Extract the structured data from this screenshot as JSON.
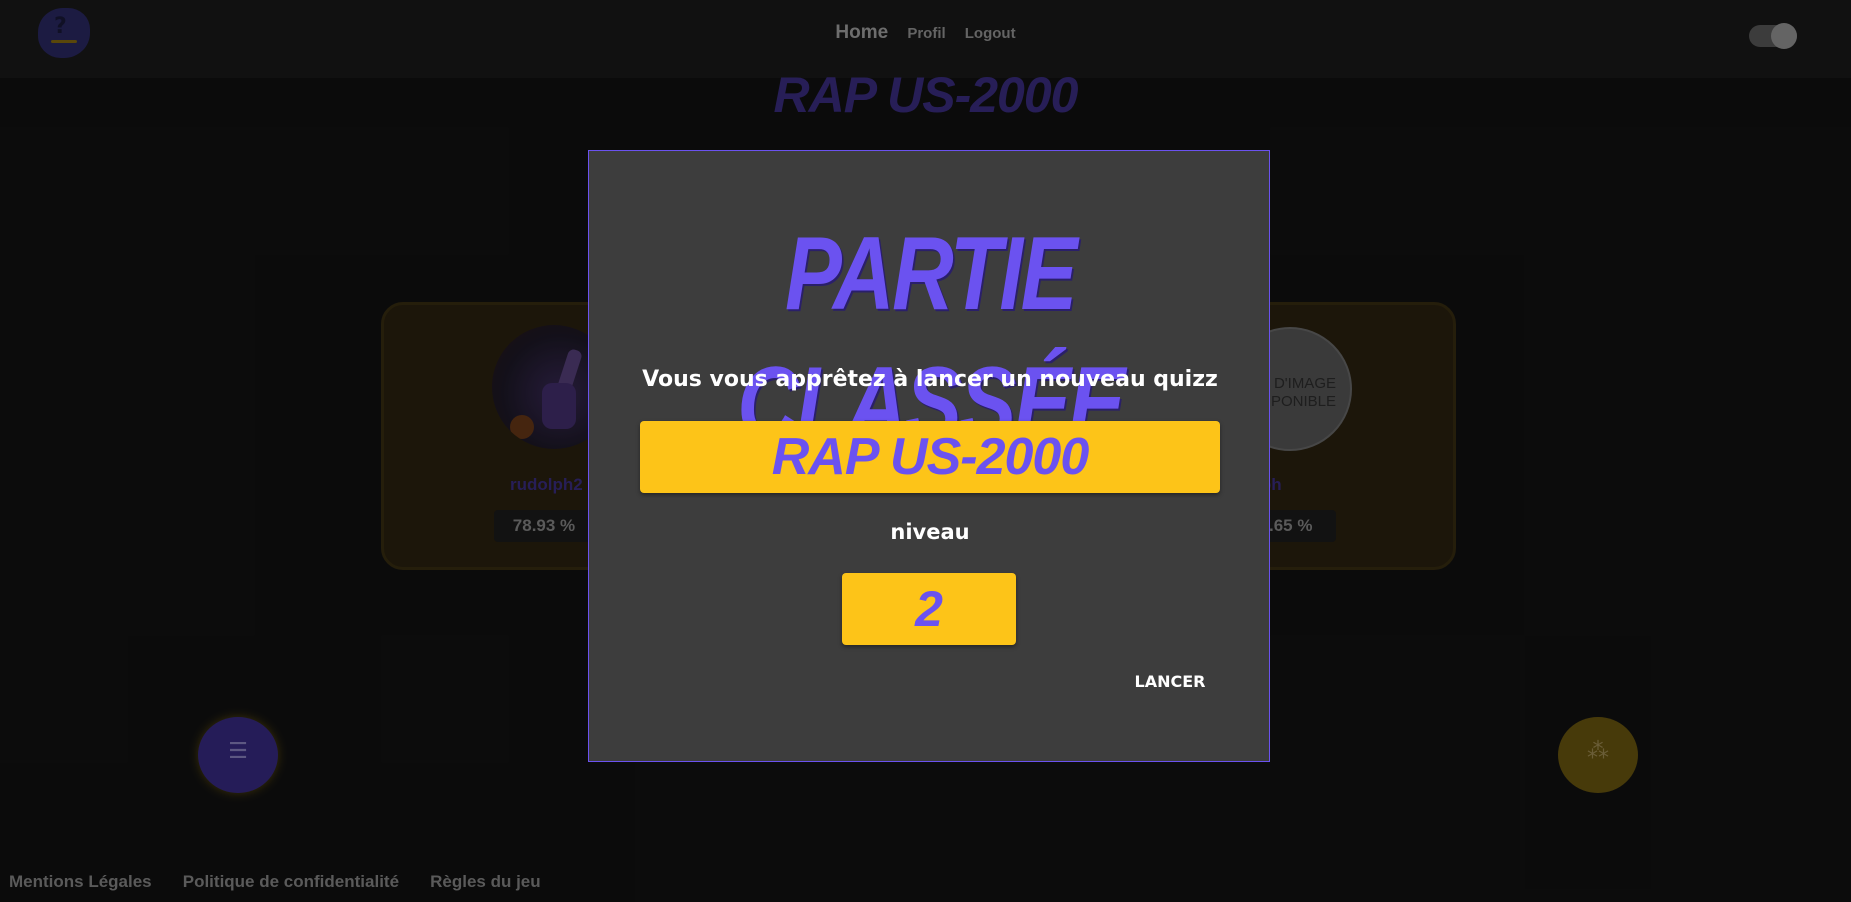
{
  "navbar": {
    "home": "Home",
    "profil": "Profil",
    "logout": "Logout"
  },
  "background": {
    "title": "RAP US-2000",
    "players": [
      {
        "name": "rudolph2",
        "score": "78.93 %"
      },
      {
        "name": "ilsoh",
        "score": "4.65 %",
        "avatar_text": "D'IMAGE PONIBLE"
      }
    ]
  },
  "footer": {
    "links": [
      "Mentions Légales",
      "Politique de confidentialité",
      "Règles du jeu"
    ]
  },
  "modal": {
    "title": "PARTIE CLASSÉE",
    "subtitle": "Vous vous apprêtez à lancer un nouveau quizz",
    "quiz_name": "RAP US-2000",
    "level_label": "niveau",
    "level_value": "2",
    "launch_label": "LANCER"
  },
  "colors": {
    "accent": "#6b52f0",
    "yellow": "#fdc418",
    "modal_bg": "#3d3d3d",
    "page_bg": "#121212"
  },
  "icons": {
    "fab_left": "list-icon",
    "fab_right": "group-icon",
    "toggle": "theme-toggle"
  }
}
